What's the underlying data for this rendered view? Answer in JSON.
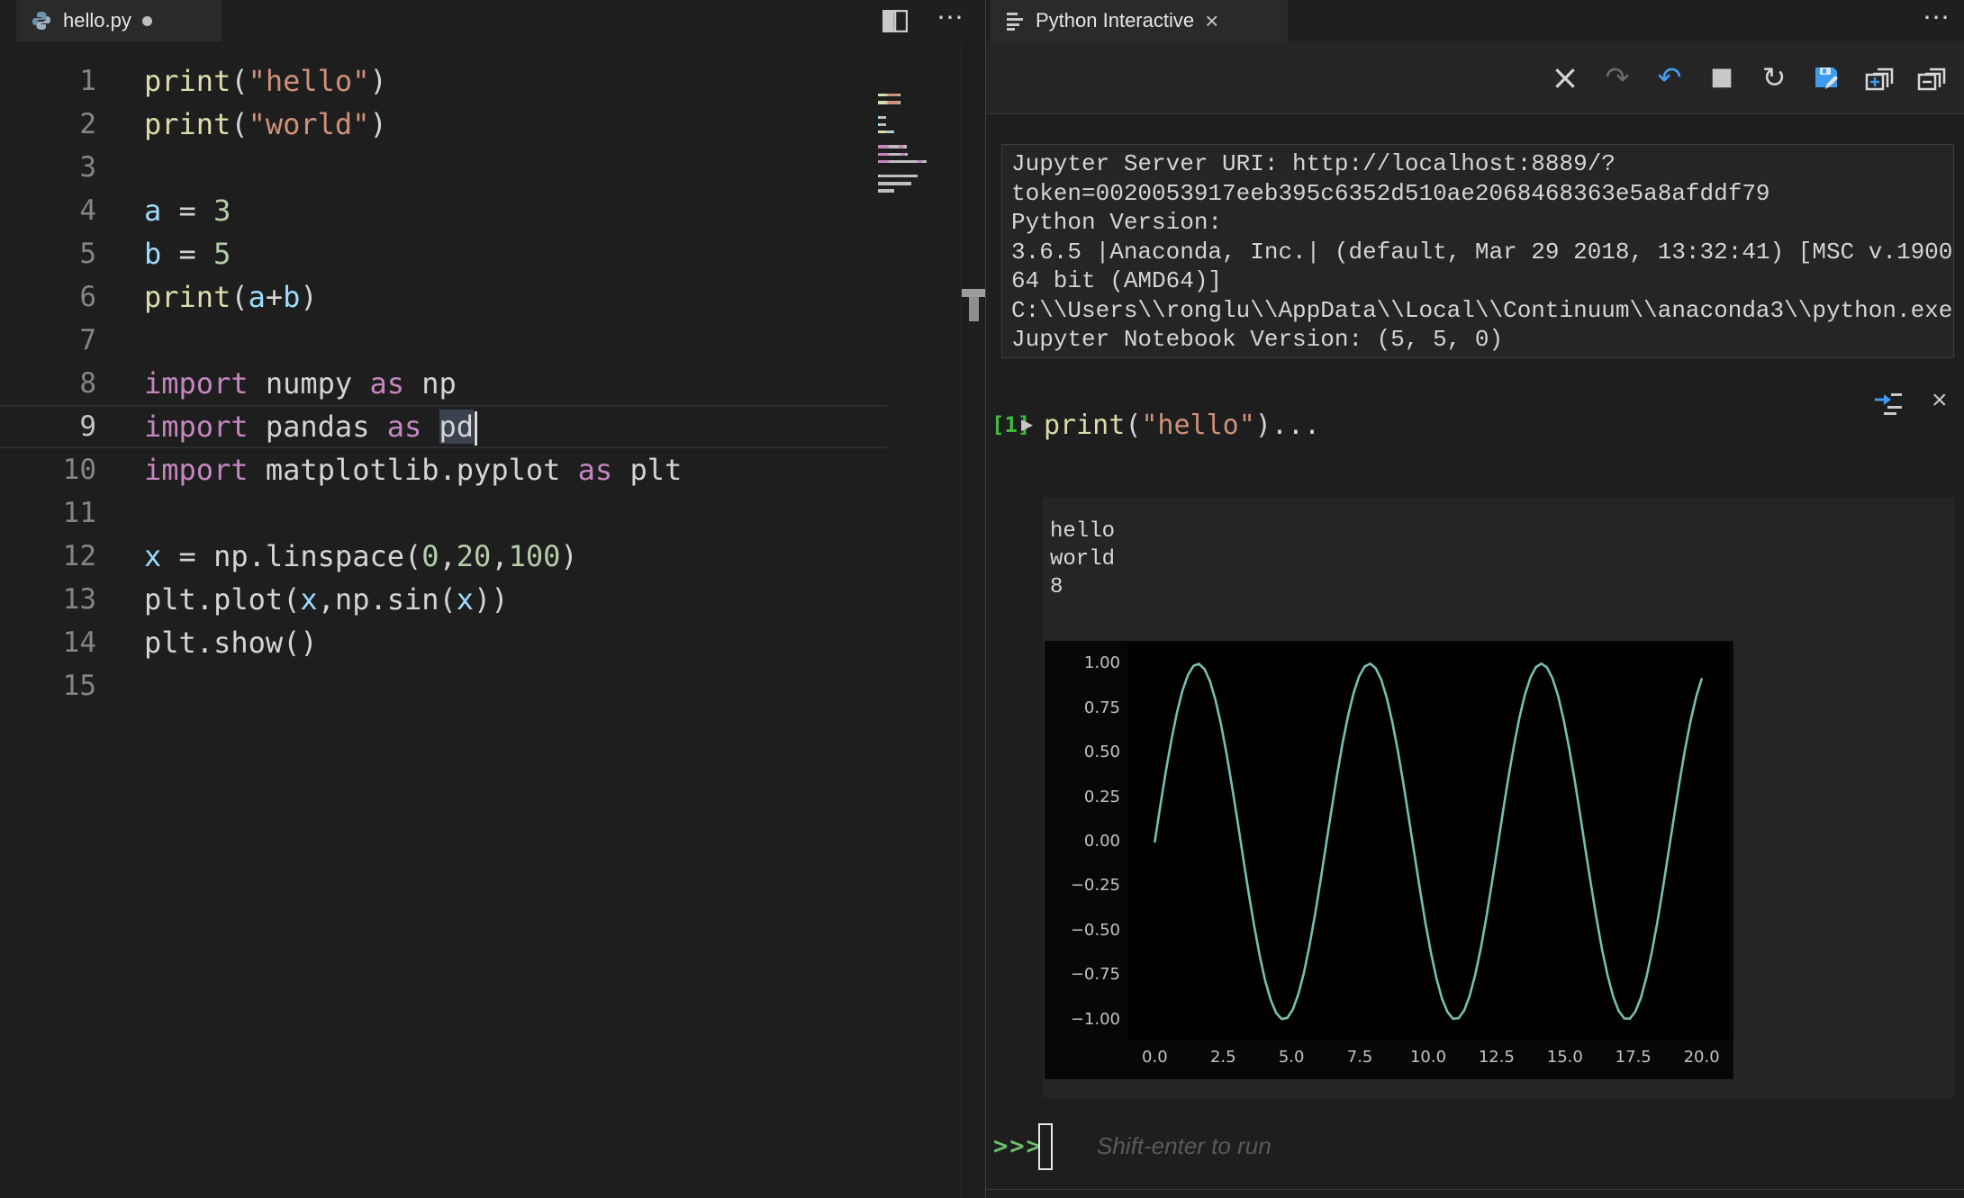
{
  "icons": {
    "more": "⋯",
    "close": "×",
    "redo": "↷",
    "undo": "↶",
    "stop": "■",
    "restart": "↻",
    "run_marker": "▶"
  },
  "editor": {
    "tab": {
      "title": "hello.py",
      "modified": true
    },
    "active_line": 9,
    "lines": [
      {
        "n": 1,
        "tokens": [
          {
            "t": "print",
            "c": "fn"
          },
          {
            "t": "(",
            "c": "pun"
          },
          {
            "t": "\"hello\"",
            "c": "str"
          },
          {
            "t": ")",
            "c": "pun"
          }
        ]
      },
      {
        "n": 2,
        "tokens": [
          {
            "t": "print",
            "c": "fn"
          },
          {
            "t": "(",
            "c": "pun"
          },
          {
            "t": "\"world\"",
            "c": "str"
          },
          {
            "t": ")",
            "c": "pun"
          }
        ]
      },
      {
        "n": 3,
        "tokens": []
      },
      {
        "n": 4,
        "tokens": [
          {
            "t": "a",
            "c": "var"
          },
          {
            "t": " = ",
            "c": "pun"
          },
          {
            "t": "3",
            "c": "num"
          }
        ]
      },
      {
        "n": 5,
        "tokens": [
          {
            "t": "b",
            "c": "var"
          },
          {
            "t": " = ",
            "c": "pun"
          },
          {
            "t": "5",
            "c": "num"
          }
        ]
      },
      {
        "n": 6,
        "tokens": [
          {
            "t": "print",
            "c": "fn"
          },
          {
            "t": "(",
            "c": "pun"
          },
          {
            "t": "a",
            "c": "var"
          },
          {
            "t": "+",
            "c": "pun"
          },
          {
            "t": "b",
            "c": "var"
          },
          {
            "t": ")",
            "c": "pun"
          }
        ]
      },
      {
        "n": 7,
        "tokens": []
      },
      {
        "n": 8,
        "tokens": [
          {
            "t": "import ",
            "c": "kw"
          },
          {
            "t": "numpy ",
            "c": "mod"
          },
          {
            "t": "as ",
            "c": "kw"
          },
          {
            "t": "np",
            "c": "mod"
          }
        ]
      },
      {
        "n": 9,
        "tokens": [
          {
            "t": "import ",
            "c": "kw"
          },
          {
            "t": "pandas ",
            "c": "mod"
          },
          {
            "t": "as ",
            "c": "kw"
          },
          {
            "t": "pd",
            "c": "mod",
            "hl": true,
            "cursor": true
          }
        ]
      },
      {
        "n": 10,
        "tokens": [
          {
            "t": "import ",
            "c": "kw"
          },
          {
            "t": "matplotlib.pyplot ",
            "c": "mod"
          },
          {
            "t": "as ",
            "c": "kw"
          },
          {
            "t": "plt",
            "c": "mod"
          }
        ]
      },
      {
        "n": 11,
        "tokens": []
      },
      {
        "n": 12,
        "tokens": [
          {
            "t": "x",
            "c": "var"
          },
          {
            "t": " = np.linspace(",
            "c": "pun"
          },
          {
            "t": "0",
            "c": "num"
          },
          {
            "t": ",",
            "c": "pun"
          },
          {
            "t": "20",
            "c": "num"
          },
          {
            "t": ",",
            "c": "pun"
          },
          {
            "t": "100",
            "c": "num"
          },
          {
            "t": ")",
            "c": "pun"
          }
        ]
      },
      {
        "n": 13,
        "tokens": [
          {
            "t": "plt.plot(",
            "c": "pun"
          },
          {
            "t": "x",
            "c": "var"
          },
          {
            "t": ",np.sin(",
            "c": "pun"
          },
          {
            "t": "x",
            "c": "var"
          },
          {
            "t": "))",
            "c": "pun"
          }
        ]
      },
      {
        "n": 14,
        "tokens": [
          {
            "t": "plt.show()",
            "c": "pun"
          }
        ]
      },
      {
        "n": 15,
        "tokens": []
      }
    ]
  },
  "interactive": {
    "tab": {
      "title": "Python Interactive"
    },
    "toolbar": [
      {
        "name": "clear-cells",
        "icon": "close-icon"
      },
      {
        "name": "redo",
        "icon": "redo-icon",
        "disabled": true
      },
      {
        "name": "undo",
        "icon": "undo-icon"
      },
      {
        "name": "interrupt-kernel",
        "icon": "stop-icon"
      },
      {
        "name": "restart-kernel",
        "icon": "restart-icon"
      },
      {
        "name": "save-as-notebook",
        "icon": "save-icon"
      },
      {
        "name": "expand-all-cells",
        "icon": "expand-all-icon"
      },
      {
        "name": "collapse-all-cells",
        "icon": "collapse-all-icon"
      }
    ],
    "server_info": [
      "Jupyter Server URI: http://localhost:8889/?",
      "token=0020053917eeb395c6352d510ae2068468363e5a8afddf79",
      "Python Version:",
      "3.6.5 |Anaconda, Inc.| (default, Mar 29 2018, 13:32:41) [MSC v.1900",
      "64 bit (AMD64)]",
      "C:\\\\Users\\\\ronglu\\\\AppData\\\\Local\\\\Continuum\\\\anaconda3\\\\python.exe",
      "Jupyter Notebook Version: (5, 5, 0)"
    ],
    "cell": {
      "execution_count": "[1]",
      "code_tokens": [
        {
          "t": "print",
          "c": "fn"
        },
        {
          "t": "(",
          "c": "pun"
        },
        {
          "t": "\"hello\"",
          "c": "str"
        },
        {
          "t": ")...",
          "c": "pun"
        }
      ]
    },
    "output_text": [
      "hello",
      "world",
      "8"
    ],
    "prompt": {
      "symbol": ">>>",
      "placeholder": "Shift-enter to run"
    }
  },
  "chart_data": {
    "type": "line",
    "title": "",
    "xlabel": "",
    "ylabel": "",
    "x_expr": "np.linspace(0,20,100)",
    "x_range": [
      0,
      20
    ],
    "n_points": 100,
    "y_formula": "sin(x)",
    "xlim": [
      -1,
      21
    ],
    "ylim": [
      -1.113,
      1.113
    ],
    "xticks": [
      "0.0",
      "2.5",
      "5.0",
      "7.5",
      "10.0",
      "12.5",
      "15.0",
      "17.5",
      "20.0"
    ],
    "xtick_values": [
      0,
      2.5,
      5,
      7.5,
      10,
      12.5,
      15,
      17.5,
      20
    ],
    "yticks": [
      "1.00",
      "0.75",
      "0.50",
      "0.25",
      "0.00",
      "−0.25",
      "−0.50",
      "−0.75",
      "−1.00"
    ],
    "ytick_values": [
      1,
      0.75,
      0.5,
      0.25,
      0,
      -0.25,
      -0.5,
      -0.75,
      -1
    ],
    "line_color": "#76c0b0",
    "bg_color": "#000000",
    "grid": false,
    "legend_position": null
  }
}
